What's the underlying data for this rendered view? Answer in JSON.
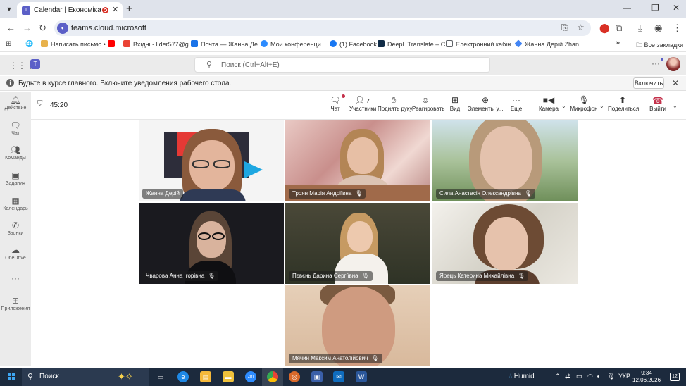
{
  "browser": {
    "tab_title": "Calendar | Економіка підпр",
    "url": "teams.cloud.microsoft",
    "bookmarks": [
      {
        "label": "Написать письмо •...",
        "color": "#e8b24c"
      },
      {
        "label": "",
        "color": "#ff0000"
      },
      {
        "label": "Вхідні - lider577@g...",
        "color": "#ea4335"
      },
      {
        "label": "Почта — Жанна Де...",
        "color": "#1a73e8"
      },
      {
        "label": "Мои конференци...",
        "color": "#2d8cff"
      },
      {
        "label": "(1) Facebook",
        "color": "#1877f2"
      },
      {
        "label": "DeepL Translate – C...",
        "color": "#0f2b46"
      },
      {
        "label": "Електронний кабін...",
        "color": "#5f6368"
      },
      {
        "label": "Жанна Дерій Zhan...",
        "color": "#4285f4"
      }
    ],
    "all_bookmarks": "Все закладки"
  },
  "teams": {
    "search_placeholder": "Поиск (Ctrl+Alt+E)"
  },
  "notice": {
    "text": "Будьте в курсе главного. Включите уведомления рабочего стола.",
    "button": "Включить"
  },
  "rail": [
    {
      "label": "Действие",
      "icon": "bell-icon",
      "glyph": "🔔"
    },
    {
      "label": "Чат",
      "icon": "chat-icon",
      "glyph": "💬"
    },
    {
      "label": "Команды",
      "icon": "teams-icon",
      "glyph": "👥"
    },
    {
      "label": "Задания",
      "icon": "assignments-icon",
      "glyph": "🎒"
    },
    {
      "label": "Календарь",
      "icon": "calendar-icon",
      "glyph": "📅"
    },
    {
      "label": "Звонки",
      "icon": "phone-icon",
      "glyph": "📞"
    },
    {
      "label": "OneDrive",
      "icon": "cloud-icon",
      "glyph": "☁"
    },
    {
      "label": "",
      "icon": "more-icon",
      "glyph": "···"
    },
    {
      "label": "Приложения",
      "icon": "apps-icon",
      "glyph": "⊞"
    }
  ],
  "meeting": {
    "timer": "45:20",
    "participants_count": "7",
    "tools": {
      "chat": "Чат",
      "participants": "Участники",
      "raise_hand": "Поднять руку",
      "react": "Реагировать",
      "view": "Вид",
      "apps": "Элементы у...",
      "more": "Еще",
      "camera": "Камера",
      "mic": "Микрофон",
      "share": "Поделиться",
      "leave": "Выйти"
    },
    "participants": [
      {
        "name": "Жанна Дерій",
        "muted": false
      },
      {
        "name": "Троян Марія Андріївна",
        "muted": true
      },
      {
        "name": "Сила Анастасія Олександрівна",
        "muted": true
      },
      {
        "name": "Чварова Анна Ігорівна",
        "muted": true
      },
      {
        "name": "Пєвєнь Дарина Сергіївна",
        "muted": true
      },
      {
        "name": "Ярець Катерина Михайлівна",
        "muted": true
      },
      {
        "name": "Мячин Максим Анатолійович",
        "muted": true
      }
    ]
  },
  "taskbar": {
    "search": "Поиск",
    "weather": "Humid",
    "language": "УКР",
    "time": "9:34",
    "date": "12.06.2026",
    "notifications": "12"
  }
}
